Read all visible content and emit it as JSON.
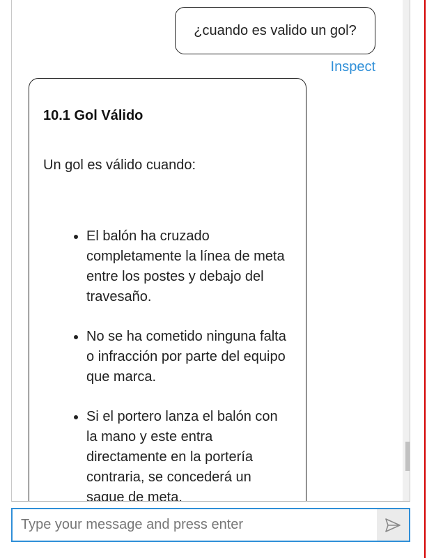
{
  "conversation": {
    "user_message": "¿cuando es valido un gol?",
    "inspect_label": "Inspect",
    "bot": {
      "title": "10.1 Gol Válido",
      "intro": "Un gol es válido cuando:",
      "bullets": [
        "El balón ha cruzado completamente la línea de meta entre los postes y debajo del travesaño.",
        "No se ha cometido ninguna falta o infracción por parte del equipo que marca.",
        "Si el portero lanza el balón con la mano y este entra directamente en la portería contraria, se concederá un saque de meta."
      ]
    }
  },
  "composer": {
    "placeholder": "Type your message and press enter",
    "value": ""
  },
  "icons": {
    "send": "send-icon",
    "scroll_up": "arrow-up-icon",
    "scroll_down": "arrow-down-icon"
  },
  "colors": {
    "accent": "#2f8fd8",
    "border_red": "#d40000"
  }
}
